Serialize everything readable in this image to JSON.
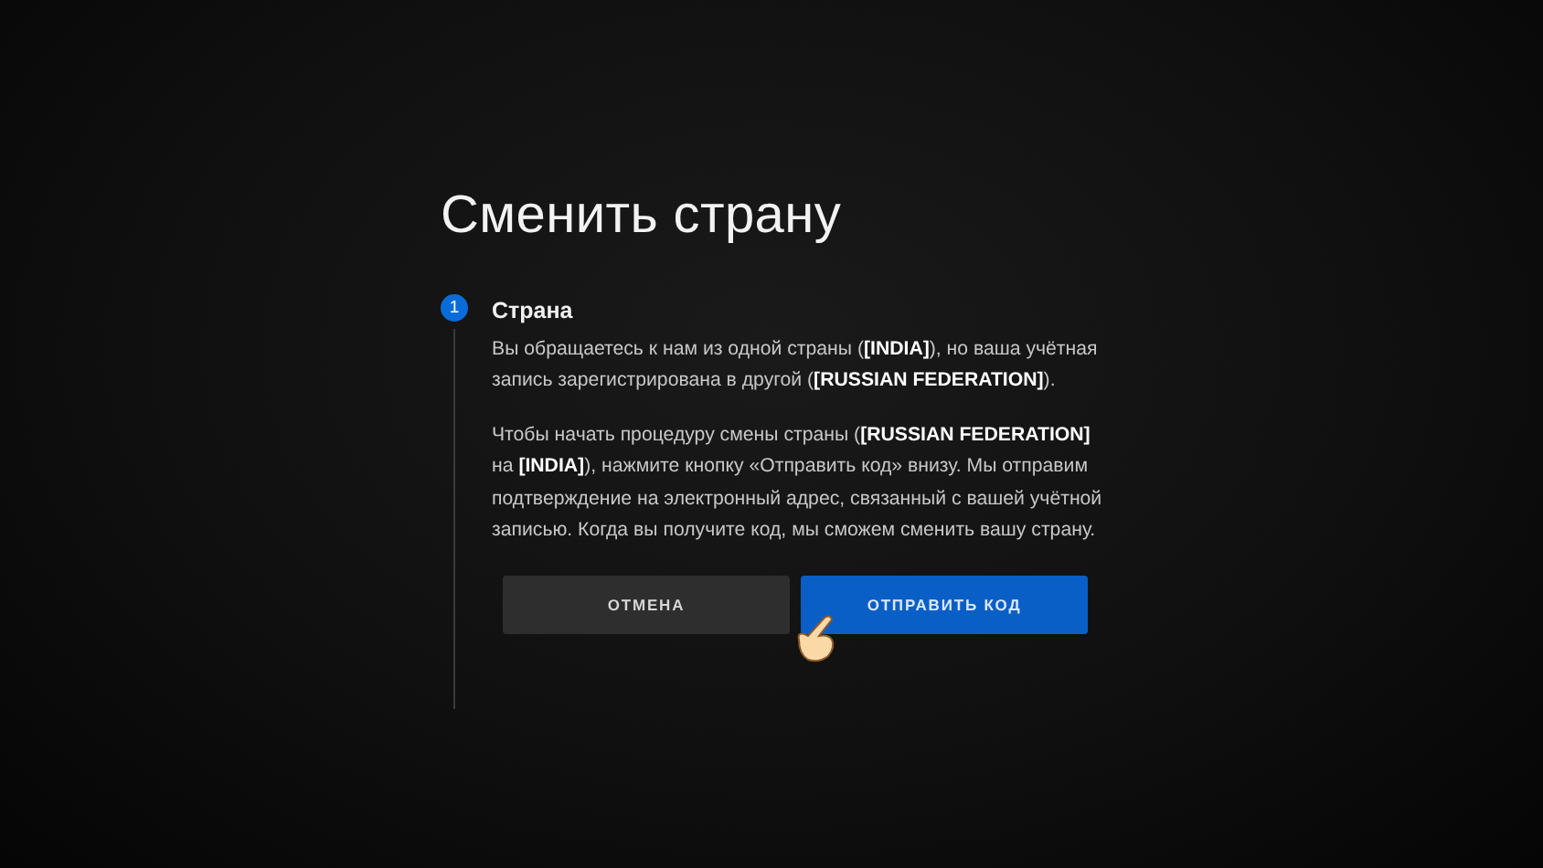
{
  "title": "Сменить страну",
  "step": {
    "number": "1",
    "heading": "Страна",
    "paragraphs": [
      "Вы обращаетесь к нам из одной страны (**[INDIA]**), но ваша учётная запись зарегистрирована в другой (**[RUSSIAN FEDERATION]**).",
      "Чтобы начать процедуру смены страны (**[RUSSIAN FEDERATION]** на **[INDIA]**), нажмите кнопку «Отправить код» внизу. Мы отправим подтверждение на электронный адрес, связанный с вашей учётной записью. Когда вы получите код, мы сможем сменить вашу страну."
    ]
  },
  "buttons": [
    {
      "label": "ОТМЕНА",
      "kind": "secondary"
    },
    {
      "label": "ОТПРАВИТЬ КОД",
      "kind": "primary"
    }
  ]
}
